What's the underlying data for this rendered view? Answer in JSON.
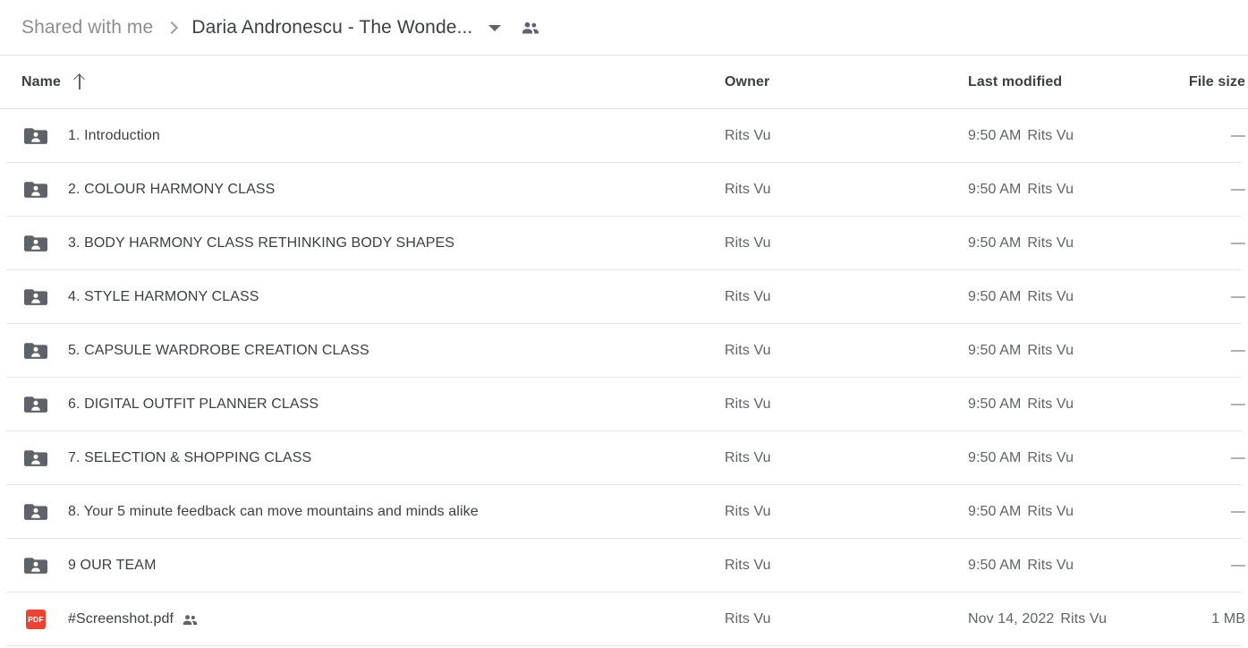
{
  "breadcrumb": {
    "parent": "Shared with me",
    "separator_icon": "chevron-right-icon",
    "current": "Daria Andronescu - The Wonde...",
    "dropdown_icon": "chevron-down-icon",
    "shared_icon": "people-icon"
  },
  "columns": {
    "name": "Name",
    "sort_icon": "arrow-up-icon",
    "owner": "Owner",
    "last_modified": "Last modified",
    "file_size": "File size"
  },
  "colors": {
    "folder_icon": "#5f6368",
    "pdf_icon": "#ea4335",
    "text_primary": "#3c4043",
    "text_secondary": "#5f6368",
    "divider": "#e8e8e8"
  },
  "rows": [
    {
      "icon": "shared-folder-icon",
      "name": "1. Introduction",
      "shared": false,
      "owner": "Rits Vu",
      "modified_date": "9:50 AM",
      "modified_by": "Rits Vu",
      "size": "—"
    },
    {
      "icon": "shared-folder-icon",
      "name": "2. COLOUR HARMONY CLASS",
      "shared": false,
      "owner": "Rits Vu",
      "modified_date": "9:50 AM",
      "modified_by": "Rits Vu",
      "size": "—"
    },
    {
      "icon": "shared-folder-icon",
      "name": "3. BODY HARMONY CLASS RETHINKING BODY SHAPES",
      "shared": false,
      "owner": "Rits Vu",
      "modified_date": "9:50 AM",
      "modified_by": "Rits Vu",
      "size": "—"
    },
    {
      "icon": "shared-folder-icon",
      "name": "4. STYLE HARMONY CLASS",
      "shared": false,
      "owner": "Rits Vu",
      "modified_date": "9:50 AM",
      "modified_by": "Rits Vu",
      "size": "—"
    },
    {
      "icon": "shared-folder-icon",
      "name": "5. CAPSULE WARDROBE CREATION CLASS",
      "shared": false,
      "owner": "Rits Vu",
      "modified_date": "9:50 AM",
      "modified_by": "Rits Vu",
      "size": "—"
    },
    {
      "icon": "shared-folder-icon",
      "name": "6. DIGITAL OUTFIT PLANNER CLASS",
      "shared": false,
      "owner": "Rits Vu",
      "modified_date": "9:50 AM",
      "modified_by": "Rits Vu",
      "size": "—"
    },
    {
      "icon": "shared-folder-icon",
      "name": "7. SELECTION & SHOPPING CLASS",
      "shared": false,
      "owner": "Rits Vu",
      "modified_date": "9:50 AM",
      "modified_by": "Rits Vu",
      "size": "—"
    },
    {
      "icon": "shared-folder-icon",
      "name": "8. Your 5 minute feedback can move mountains and minds alike",
      "shared": false,
      "owner": "Rits Vu",
      "modified_date": "9:50 AM",
      "modified_by": "Rits Vu",
      "size": "—"
    },
    {
      "icon": "shared-folder-icon",
      "name": "9 OUR TEAM",
      "shared": false,
      "owner": "Rits Vu",
      "modified_date": "9:50 AM",
      "modified_by": "Rits Vu",
      "size": "—"
    },
    {
      "icon": "pdf-file-icon",
      "icon_label": "PDF",
      "name": "#Screenshot.pdf",
      "shared": true,
      "owner": "Rits Vu",
      "modified_date": "Nov 14, 2022",
      "modified_by": "Rits Vu",
      "size": "1 MB"
    }
  ]
}
